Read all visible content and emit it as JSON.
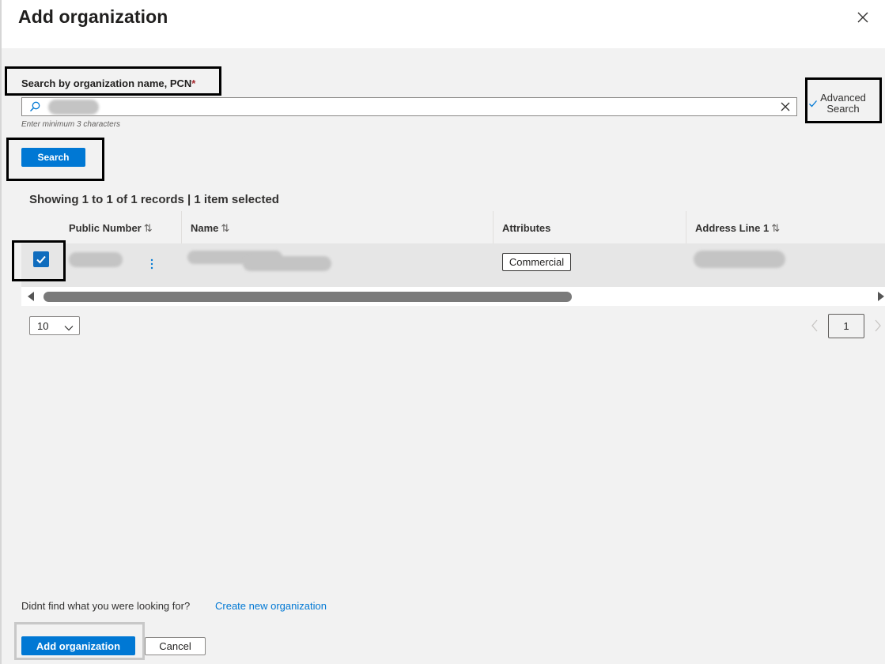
{
  "dialog": {
    "title": "Add organization",
    "close_icon": "close-icon"
  },
  "search": {
    "label": "Search by organization name, PCN",
    "required_marker": "*",
    "value": "",
    "hint": "Enter minimum 3 characters",
    "search_icon": "search-icon",
    "clear_icon": "clear-icon",
    "button_label": "Search"
  },
  "advanced_search": {
    "line1": "Advanced",
    "line2": "Search",
    "icon": "checkmark-icon"
  },
  "results": {
    "summary": "Showing 1 to 1 of 1 records | 1 item selected",
    "columns": [
      {
        "label": "Public Number",
        "sort_icon": "sort-icon"
      },
      {
        "label": "Name",
        "sort_icon": "sort-icon"
      },
      {
        "label": "Attributes"
      },
      {
        "label": "Address Line 1",
        "sort_icon": "sort-icon"
      }
    ],
    "rows": [
      {
        "selected": true,
        "public_number": "",
        "name": "",
        "attributes": [
          "Commercial"
        ],
        "address_line_1": ""
      }
    ]
  },
  "pagination": {
    "page_size": "10",
    "current_page": "1"
  },
  "footer": {
    "not_found_text": "Didnt find what you were looking for?",
    "create_link": "Create new organization",
    "add_button": "Add organization",
    "cancel_button": "Cancel"
  },
  "colors": {
    "accent": "#0078d4",
    "panel_background": "#f2f2f2",
    "row_selected": "#e6e6e6",
    "required": "#a4262c"
  }
}
